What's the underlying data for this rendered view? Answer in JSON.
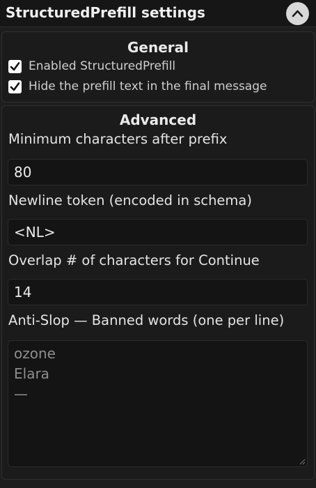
{
  "header": {
    "title": "StructuredPrefill settings",
    "collapse_icon": "chevron-up-icon"
  },
  "general": {
    "title": "General",
    "checkboxes": [
      {
        "label": "Enabled StructuredPrefill",
        "checked": true
      },
      {
        "label": "Hide the prefill text in the final message",
        "checked": true
      }
    ]
  },
  "advanced": {
    "title": "Advanced",
    "min_chars": {
      "label": "Minimum characters after prefix",
      "value": "80"
    },
    "newline_token": {
      "label": "Newline token (encoded in schema)",
      "value": "<NL>"
    },
    "overlap": {
      "label": "Overlap # of characters for Continue",
      "value": "14"
    },
    "anti_slop": {
      "label": "Anti-Slop — Banned words (one per line)",
      "lines": [
        "ozone",
        "Elara",
        "—"
      ]
    }
  },
  "colors": {
    "background": "#1e1e1e",
    "panel": "#1b1b1b",
    "input": "#141414",
    "button": "#d8d8d8"
  }
}
